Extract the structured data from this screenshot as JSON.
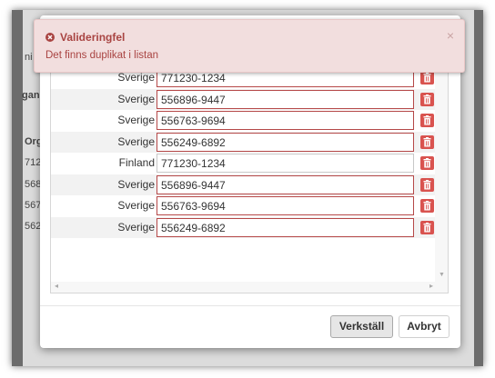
{
  "background": {
    "fragments": [
      "ni",
      "gan",
      "Org.r",
      "712",
      "568",
      "567",
      "562"
    ]
  },
  "alert": {
    "title": "Valideringfel",
    "message": "Det finns duplikat i listan",
    "close_symbol": "×",
    "icon": "error-circle-icon",
    "color": "#a94442",
    "bg": "#f2dede"
  },
  "rows": [
    {
      "country": "Sverige",
      "orgnr": "771230-1234",
      "duplicate": true
    },
    {
      "country": "Sverige",
      "orgnr": "556896-9447",
      "duplicate": true
    },
    {
      "country": "Sverige",
      "orgnr": "556763-9694",
      "duplicate": true
    },
    {
      "country": "Sverige",
      "orgnr": "556249-6892",
      "duplicate": true
    },
    {
      "country": "Finland",
      "orgnr": "771230-1234",
      "duplicate": false
    },
    {
      "country": "Sverige",
      "orgnr": "556896-9447",
      "duplicate": true
    },
    {
      "country": "Sverige",
      "orgnr": "556763-9694",
      "duplicate": true
    },
    {
      "country": "Sverige",
      "orgnr": "556249-6892",
      "duplicate": true
    }
  ],
  "row_action_icon": "trash-icon",
  "delete_color": "#d9534f",
  "footer": {
    "apply_label": "Verkställ",
    "cancel_label": "Avbryt"
  }
}
